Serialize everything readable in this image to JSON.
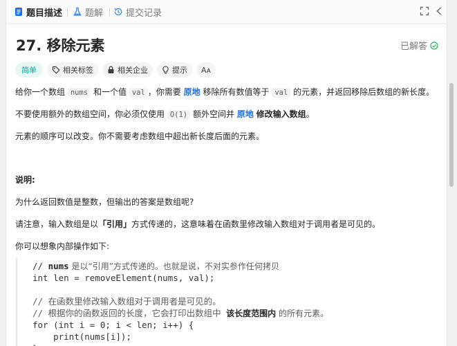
{
  "tabs": [
    {
      "label": "题目描述",
      "icon": "document-icon",
      "active": true
    },
    {
      "label": "题解",
      "icon": "flask-icon",
      "active": false
    },
    {
      "label": "提交记录",
      "icon": "history-icon",
      "active": false
    }
  ],
  "problem": {
    "title": "27. 移除元素",
    "solved_label": "已解答"
  },
  "tags": {
    "difficulty": "简单",
    "related_tags": "相关标签",
    "related_companies": "相关企业",
    "hint": "提示",
    "font_toggle": "Aᴀ"
  },
  "desc": {
    "l1a": "给你一个数组",
    "l1_code1": "nums",
    "l1b": "和一个值",
    "l1_code2": "val",
    "l1c": "，你需要",
    "l1_bold": "原地",
    "l1d": "移除所有数值等于",
    "l1_code3": "val",
    "l1e": "的元素，并返回移除后数组的新长度。",
    "l2a": "不要使用额外的数组空间，你必须仅使用",
    "l2_code": "O(1)",
    "l2b": "额外空间并",
    "l2_bold1": "原地",
    "l2_bold2": "修改输入数组",
    "l2c": "。",
    "l3": "元素的顺序可以改变。你不需要考虑数组中超出新长度后面的元素。",
    "heading": "说明:",
    "l4": "为什么返回数值是整数，但输出的答案是数组呢?",
    "l5a": "请注意，输入数组是以",
    "l5_bold": "「引用」",
    "l5b": "方式传递的，这意味着在函数里修改输入数组对于调用者是可见的。",
    "l6": "你可以想象内部操作如下:"
  },
  "code": {
    "c1a": "// ",
    "c1_bold": "nums",
    "c1b": " 是以“引用”方式传递的。也就是说，不对实参作任何拷贝",
    "c2": "int len = removeElement(nums, val);",
    "c3": "// 在函数里修改输入数组对于调用者是可见的。",
    "c4a": "// 根据你的函数返回的长度，它会打印出数组中 ",
    "c4_bold": "该长度范围内",
    "c4b": " 的所有元素。",
    "c5": "for (int i = 0; i < len; i++) {",
    "c6": "    print(nums[i]);",
    "c7": "}"
  },
  "colors": {
    "easy": "#00af9b",
    "link": "#1a6fe8",
    "solved_check": "#2db55d"
  }
}
